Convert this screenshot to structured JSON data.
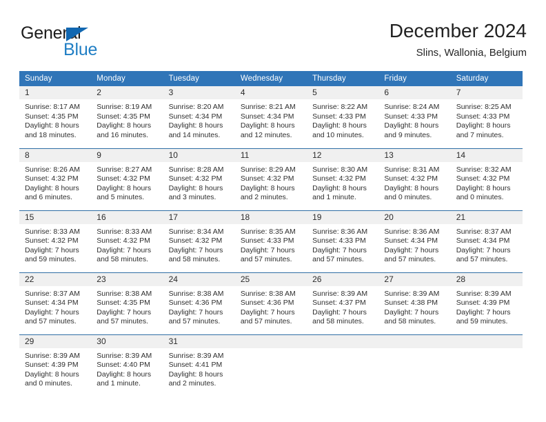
{
  "logo": {
    "word_top": "General",
    "word_bottom": "Blue",
    "triangle_color": "#1167b1",
    "blue_text_color": "#1f7ec4"
  },
  "header": {
    "title": "December 2024",
    "subtitle": "Slins, Wallonia, Belgium",
    "header_bg": "#3075b8",
    "daynum_bg": "#f0f0f0",
    "separator_color": "#2e6da4"
  },
  "weekdays": [
    "Sunday",
    "Monday",
    "Tuesday",
    "Wednesday",
    "Thursday",
    "Friday",
    "Saturday"
  ],
  "weeks": [
    [
      {
        "day": "1",
        "sunrise": "Sunrise: 8:17 AM",
        "sunset": "Sunset: 4:35 PM",
        "daylight1": "Daylight: 8 hours",
        "daylight2": "and 18 minutes."
      },
      {
        "day": "2",
        "sunrise": "Sunrise: 8:19 AM",
        "sunset": "Sunset: 4:35 PM",
        "daylight1": "Daylight: 8 hours",
        "daylight2": "and 16 minutes."
      },
      {
        "day": "3",
        "sunrise": "Sunrise: 8:20 AM",
        "sunset": "Sunset: 4:34 PM",
        "daylight1": "Daylight: 8 hours",
        "daylight2": "and 14 minutes."
      },
      {
        "day": "4",
        "sunrise": "Sunrise: 8:21 AM",
        "sunset": "Sunset: 4:34 PM",
        "daylight1": "Daylight: 8 hours",
        "daylight2": "and 12 minutes."
      },
      {
        "day": "5",
        "sunrise": "Sunrise: 8:22 AM",
        "sunset": "Sunset: 4:33 PM",
        "daylight1": "Daylight: 8 hours",
        "daylight2": "and 10 minutes."
      },
      {
        "day": "6",
        "sunrise": "Sunrise: 8:24 AM",
        "sunset": "Sunset: 4:33 PM",
        "daylight1": "Daylight: 8 hours",
        "daylight2": "and 9 minutes."
      },
      {
        "day": "7",
        "sunrise": "Sunrise: 8:25 AM",
        "sunset": "Sunset: 4:33 PM",
        "daylight1": "Daylight: 8 hours",
        "daylight2": "and 7 minutes."
      }
    ],
    [
      {
        "day": "8",
        "sunrise": "Sunrise: 8:26 AM",
        "sunset": "Sunset: 4:32 PM",
        "daylight1": "Daylight: 8 hours",
        "daylight2": "and 6 minutes."
      },
      {
        "day": "9",
        "sunrise": "Sunrise: 8:27 AM",
        "sunset": "Sunset: 4:32 PM",
        "daylight1": "Daylight: 8 hours",
        "daylight2": "and 5 minutes."
      },
      {
        "day": "10",
        "sunrise": "Sunrise: 8:28 AM",
        "sunset": "Sunset: 4:32 PM",
        "daylight1": "Daylight: 8 hours",
        "daylight2": "and 3 minutes."
      },
      {
        "day": "11",
        "sunrise": "Sunrise: 8:29 AM",
        "sunset": "Sunset: 4:32 PM",
        "daylight1": "Daylight: 8 hours",
        "daylight2": "and 2 minutes."
      },
      {
        "day": "12",
        "sunrise": "Sunrise: 8:30 AM",
        "sunset": "Sunset: 4:32 PM",
        "daylight1": "Daylight: 8 hours",
        "daylight2": "and 1 minute."
      },
      {
        "day": "13",
        "sunrise": "Sunrise: 8:31 AM",
        "sunset": "Sunset: 4:32 PM",
        "daylight1": "Daylight: 8 hours",
        "daylight2": "and 0 minutes."
      },
      {
        "day": "14",
        "sunrise": "Sunrise: 8:32 AM",
        "sunset": "Sunset: 4:32 PM",
        "daylight1": "Daylight: 8 hours",
        "daylight2": "and 0 minutes."
      }
    ],
    [
      {
        "day": "15",
        "sunrise": "Sunrise: 8:33 AM",
        "sunset": "Sunset: 4:32 PM",
        "daylight1": "Daylight: 7 hours",
        "daylight2": "and 59 minutes."
      },
      {
        "day": "16",
        "sunrise": "Sunrise: 8:33 AM",
        "sunset": "Sunset: 4:32 PM",
        "daylight1": "Daylight: 7 hours",
        "daylight2": "and 58 minutes."
      },
      {
        "day": "17",
        "sunrise": "Sunrise: 8:34 AM",
        "sunset": "Sunset: 4:32 PM",
        "daylight1": "Daylight: 7 hours",
        "daylight2": "and 58 minutes."
      },
      {
        "day": "18",
        "sunrise": "Sunrise: 8:35 AM",
        "sunset": "Sunset: 4:33 PM",
        "daylight1": "Daylight: 7 hours",
        "daylight2": "and 57 minutes."
      },
      {
        "day": "19",
        "sunrise": "Sunrise: 8:36 AM",
        "sunset": "Sunset: 4:33 PM",
        "daylight1": "Daylight: 7 hours",
        "daylight2": "and 57 minutes."
      },
      {
        "day": "20",
        "sunrise": "Sunrise: 8:36 AM",
        "sunset": "Sunset: 4:34 PM",
        "daylight1": "Daylight: 7 hours",
        "daylight2": "and 57 minutes."
      },
      {
        "day": "21",
        "sunrise": "Sunrise: 8:37 AM",
        "sunset": "Sunset: 4:34 PM",
        "daylight1": "Daylight: 7 hours",
        "daylight2": "and 57 minutes."
      }
    ],
    [
      {
        "day": "22",
        "sunrise": "Sunrise: 8:37 AM",
        "sunset": "Sunset: 4:34 PM",
        "daylight1": "Daylight: 7 hours",
        "daylight2": "and 57 minutes."
      },
      {
        "day": "23",
        "sunrise": "Sunrise: 8:38 AM",
        "sunset": "Sunset: 4:35 PM",
        "daylight1": "Daylight: 7 hours",
        "daylight2": "and 57 minutes."
      },
      {
        "day": "24",
        "sunrise": "Sunrise: 8:38 AM",
        "sunset": "Sunset: 4:36 PM",
        "daylight1": "Daylight: 7 hours",
        "daylight2": "and 57 minutes."
      },
      {
        "day": "25",
        "sunrise": "Sunrise: 8:38 AM",
        "sunset": "Sunset: 4:36 PM",
        "daylight1": "Daylight: 7 hours",
        "daylight2": "and 57 minutes."
      },
      {
        "day": "26",
        "sunrise": "Sunrise: 8:39 AM",
        "sunset": "Sunset: 4:37 PM",
        "daylight1": "Daylight: 7 hours",
        "daylight2": "and 58 minutes."
      },
      {
        "day": "27",
        "sunrise": "Sunrise: 8:39 AM",
        "sunset": "Sunset: 4:38 PM",
        "daylight1": "Daylight: 7 hours",
        "daylight2": "and 58 minutes."
      },
      {
        "day": "28",
        "sunrise": "Sunrise: 8:39 AM",
        "sunset": "Sunset: 4:39 PM",
        "daylight1": "Daylight: 7 hours",
        "daylight2": "and 59 minutes."
      }
    ],
    [
      {
        "day": "29",
        "sunrise": "Sunrise: 8:39 AM",
        "sunset": "Sunset: 4:39 PM",
        "daylight1": "Daylight: 8 hours",
        "daylight2": "and 0 minutes."
      },
      {
        "day": "30",
        "sunrise": "Sunrise: 8:39 AM",
        "sunset": "Sunset: 4:40 PM",
        "daylight1": "Daylight: 8 hours",
        "daylight2": "and 1 minute."
      },
      {
        "day": "31",
        "sunrise": "Sunrise: 8:39 AM",
        "sunset": "Sunset: 4:41 PM",
        "daylight1": "Daylight: 8 hours",
        "daylight2": "and 2 minutes."
      },
      {
        "day": "",
        "sunrise": "",
        "sunset": "",
        "daylight1": "",
        "daylight2": ""
      },
      {
        "day": "",
        "sunrise": "",
        "sunset": "",
        "daylight1": "",
        "daylight2": ""
      },
      {
        "day": "",
        "sunrise": "",
        "sunset": "",
        "daylight1": "",
        "daylight2": ""
      },
      {
        "day": "",
        "sunrise": "",
        "sunset": "",
        "daylight1": "",
        "daylight2": ""
      }
    ]
  ]
}
